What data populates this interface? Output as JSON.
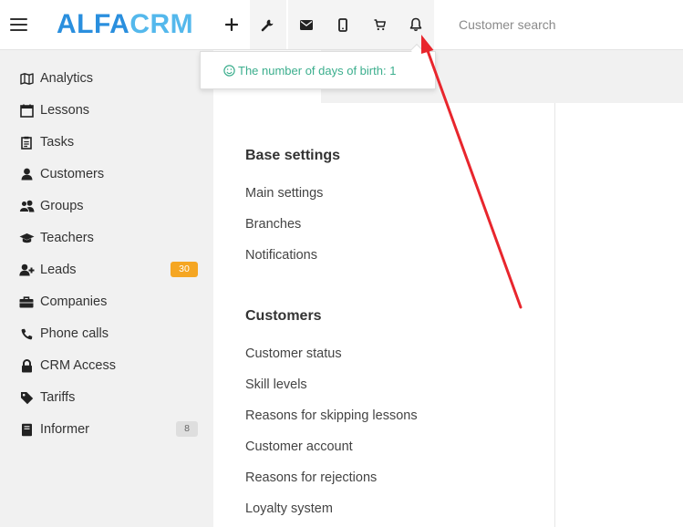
{
  "app": {
    "logo_part1": "ALFA",
    "logo_part2": "CRM"
  },
  "toolbar": {
    "tools": [
      {
        "name": "add-icon",
        "label": "Add"
      },
      {
        "name": "wrench-icon",
        "label": "Settings"
      },
      {
        "name": "mail-icon",
        "label": "Mail"
      },
      {
        "name": "phone-icon",
        "label": "Mobile"
      },
      {
        "name": "cart-icon",
        "label": "Cart"
      },
      {
        "name": "bell-icon",
        "label": "Notifications"
      }
    ],
    "search_placeholder": "Customer search"
  },
  "notification": {
    "icon": "smile-icon",
    "text": "The number of days of birth: 1"
  },
  "sidebar": {
    "items": [
      {
        "label": "Analytics",
        "icon": "map-icon"
      },
      {
        "label": "Lessons",
        "icon": "calendar-icon"
      },
      {
        "label": "Tasks",
        "icon": "clipboard-icon"
      },
      {
        "label": "Customers",
        "icon": "user-icon"
      },
      {
        "label": "Groups",
        "icon": "users-icon"
      },
      {
        "label": "Teachers",
        "icon": "graduation-cap-icon"
      },
      {
        "label": "Leads",
        "icon": "user-plus-icon",
        "badge": "30"
      },
      {
        "label": "Companies",
        "icon": "briefcase-icon"
      },
      {
        "label": "Phone calls",
        "icon": "phone-call-icon"
      },
      {
        "label": "CRM Access",
        "icon": "lock-icon"
      },
      {
        "label": "Tariffs",
        "icon": "tag-icon"
      },
      {
        "label": "Informer",
        "icon": "book-icon",
        "badge": "8"
      }
    ]
  },
  "settings": {
    "sections": [
      {
        "title": "Base settings",
        "links": [
          "Main settings",
          "Branches",
          "Notifications"
        ]
      },
      {
        "title": "Customers",
        "links": [
          "Customer status",
          "Skill levels",
          "Reasons for skipping lessons",
          "Customer account",
          "Reasons for rejections",
          "Loyalty system"
        ]
      }
    ]
  },
  "colors": {
    "logo_primary": "#2a8fde",
    "logo_secondary": "#54b8ec",
    "notification_text": "#3bae8d",
    "badge_orange": "#f5a623",
    "annotation_arrow": "#e8262d"
  }
}
